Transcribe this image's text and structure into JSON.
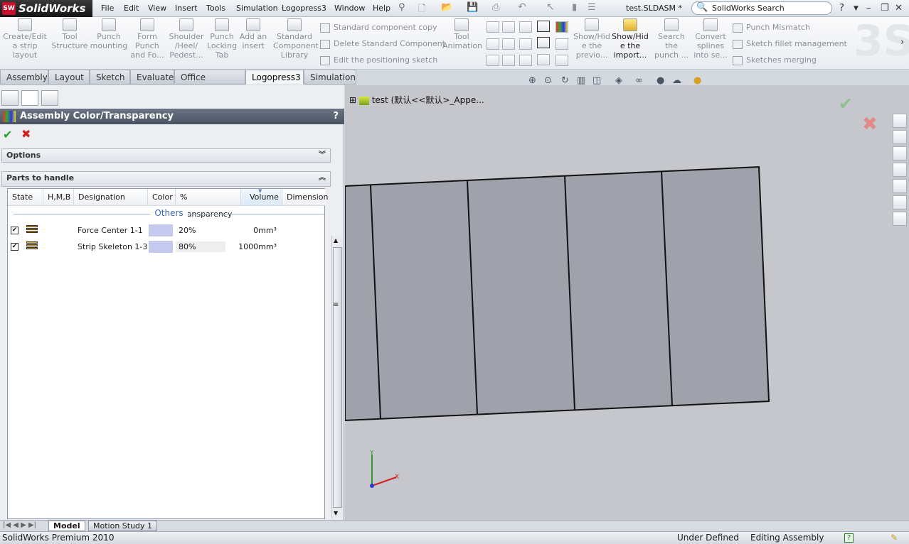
{
  "app": {
    "name": "SolidWorks",
    "logo_badge": "SW",
    "document_title": "test.SLDASM *"
  },
  "menu": [
    "File",
    "Edit",
    "View",
    "Insert",
    "Tools",
    "Simulation",
    "Logopress3",
    "Window",
    "Help"
  ],
  "search": {
    "placeholder": "SolidWorks Search"
  },
  "window_controls": {
    "help": "?",
    "minimize": "–",
    "restore": "❐",
    "close": "✕"
  },
  "ribbon": {
    "large_buttons": [
      {
        "label": "Create/Edit a strip layout",
        "lines": [
          "Create/Edit",
          "a strip",
          "layout"
        ]
      },
      {
        "label": "Tool Structure",
        "lines": [
          "Tool",
          "Structure"
        ]
      },
      {
        "label": "Punch mounting",
        "lines": [
          "Punch",
          "mounting"
        ]
      },
      {
        "label": "Form Punch and Fo...",
        "lines": [
          "Form",
          "Punch",
          "and Fo..."
        ]
      },
      {
        "label": "Shoulder /Heel/ Pedest...",
        "lines": [
          "Shoulder",
          "/Heel/",
          "Pedest..."
        ]
      },
      {
        "label": "Punch Locking Tab",
        "lines": [
          "Punch",
          "Locking",
          "Tab"
        ]
      },
      {
        "label": "Add an insert",
        "lines": [
          "Add an",
          "insert"
        ]
      },
      {
        "label": "Standard Component Library",
        "lines": [
          "Standard",
          "Component",
          "Library"
        ]
      },
      {
        "label": "Tool Animation",
        "lines": [
          "Tool",
          "Animation"
        ]
      },
      {
        "label": "Show/Hide the previo...",
        "lines": [
          "Show/Hid",
          "e the",
          "previo..."
        ]
      },
      {
        "label": "Show/Hide the import...",
        "lines": [
          "Show/Hid",
          "e the",
          "import..."
        ]
      },
      {
        "label": "Search the punch ...",
        "lines": [
          "Search",
          "the",
          "punch ..."
        ]
      },
      {
        "label": "Convert splines into se...",
        "lines": [
          "Convert",
          "splines",
          "into se..."
        ]
      }
    ],
    "small_buttons_a": [
      "Standard component copy",
      "Delete Standard Component",
      "Edit the positioning sketch"
    ],
    "small_buttons_b": [
      "Punch Mismatch",
      "Sketch fillet management",
      "Sketches merging"
    ]
  },
  "tabs": [
    "Assembly",
    "Layout",
    "Sketch",
    "Evaluate",
    "Office Products",
    "Logopress3",
    "Simulation"
  ],
  "active_tab": "Logopress3",
  "panel": {
    "title": "Assembly Color/Transparency",
    "help": "?",
    "ok_symbol": "✔",
    "cancel_symbol": "✖",
    "options_label": "Options",
    "parts_label": "Parts to handle",
    "chevron_collapsed": "︾",
    "chevron_expanded": "︽",
    "columns": [
      "State",
      "H,M,B",
      "Designation",
      "Color",
      "% Transparency",
      "Volume",
      "Dimension"
    ],
    "group_label": "Others",
    "rows": [
      {
        "checked": true,
        "designation": "Force Center 1-1",
        "color": "#c4c9ee",
        "transparency": "20%",
        "transparency_value": 20,
        "volume": "0mm³"
      },
      {
        "checked": true,
        "designation": "Strip Skeleton 1-3",
        "color": "#c4c9ee",
        "transparency": "80%",
        "transparency_value": 80,
        "volume": "1000mm³"
      }
    ]
  },
  "viewport": {
    "tree_label": "test  (默认<<默认>_Appe...",
    "tree_expand": "⊞",
    "axis_x": "X",
    "axis_y": "Y",
    "view_toolbar_icons": [
      "zoom-to-fit-icon",
      "zoom-area-icon",
      "rotate-icon",
      "section-view-icon",
      "view-orientation-icon",
      "display-style-icon",
      "hide-show-icon",
      "edit-appearance-icon",
      "apply-scene-icon",
      "view-settings-icon"
    ],
    "ok_symbol": "✔",
    "cancel_symbol": "✖"
  },
  "bottom_tabs": [
    "Model",
    "Motion Study 1"
  ],
  "status": {
    "product": "SolidWorks Premium 2010",
    "state": "Under Defined",
    "mode": "Editing Assembly",
    "help": "?"
  }
}
